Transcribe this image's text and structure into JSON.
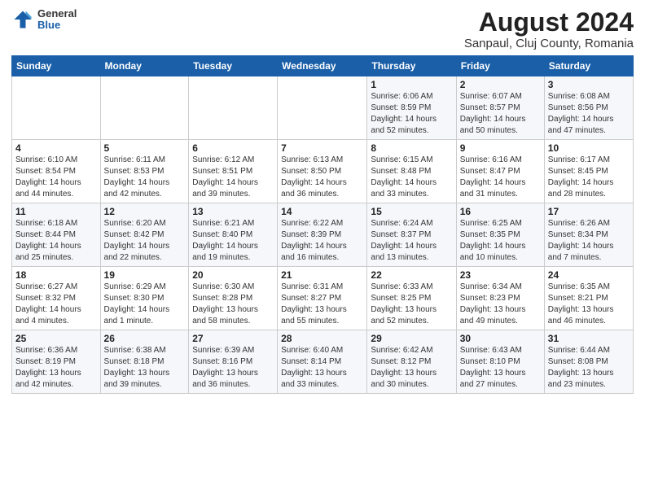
{
  "header": {
    "logo_general": "General",
    "logo_blue": "Blue",
    "title": "August 2024",
    "subtitle": "Sanpaul, Cluj County, Romania"
  },
  "weekdays": [
    "Sunday",
    "Monday",
    "Tuesday",
    "Wednesday",
    "Thursday",
    "Friday",
    "Saturday"
  ],
  "weeks": [
    [
      {
        "day": "",
        "info": ""
      },
      {
        "day": "",
        "info": ""
      },
      {
        "day": "",
        "info": ""
      },
      {
        "day": "",
        "info": ""
      },
      {
        "day": "1",
        "info": "Sunrise: 6:06 AM\nSunset: 8:59 PM\nDaylight: 14 hours\nand 52 minutes."
      },
      {
        "day": "2",
        "info": "Sunrise: 6:07 AM\nSunset: 8:57 PM\nDaylight: 14 hours\nand 50 minutes."
      },
      {
        "day": "3",
        "info": "Sunrise: 6:08 AM\nSunset: 8:56 PM\nDaylight: 14 hours\nand 47 minutes."
      }
    ],
    [
      {
        "day": "4",
        "info": "Sunrise: 6:10 AM\nSunset: 8:54 PM\nDaylight: 14 hours\nand 44 minutes."
      },
      {
        "day": "5",
        "info": "Sunrise: 6:11 AM\nSunset: 8:53 PM\nDaylight: 14 hours\nand 42 minutes."
      },
      {
        "day": "6",
        "info": "Sunrise: 6:12 AM\nSunset: 8:51 PM\nDaylight: 14 hours\nand 39 minutes."
      },
      {
        "day": "7",
        "info": "Sunrise: 6:13 AM\nSunset: 8:50 PM\nDaylight: 14 hours\nand 36 minutes."
      },
      {
        "day": "8",
        "info": "Sunrise: 6:15 AM\nSunset: 8:48 PM\nDaylight: 14 hours\nand 33 minutes."
      },
      {
        "day": "9",
        "info": "Sunrise: 6:16 AM\nSunset: 8:47 PM\nDaylight: 14 hours\nand 31 minutes."
      },
      {
        "day": "10",
        "info": "Sunrise: 6:17 AM\nSunset: 8:45 PM\nDaylight: 14 hours\nand 28 minutes."
      }
    ],
    [
      {
        "day": "11",
        "info": "Sunrise: 6:18 AM\nSunset: 8:44 PM\nDaylight: 14 hours\nand 25 minutes."
      },
      {
        "day": "12",
        "info": "Sunrise: 6:20 AM\nSunset: 8:42 PM\nDaylight: 14 hours\nand 22 minutes."
      },
      {
        "day": "13",
        "info": "Sunrise: 6:21 AM\nSunset: 8:40 PM\nDaylight: 14 hours\nand 19 minutes."
      },
      {
        "day": "14",
        "info": "Sunrise: 6:22 AM\nSunset: 8:39 PM\nDaylight: 14 hours\nand 16 minutes."
      },
      {
        "day": "15",
        "info": "Sunrise: 6:24 AM\nSunset: 8:37 PM\nDaylight: 14 hours\nand 13 minutes."
      },
      {
        "day": "16",
        "info": "Sunrise: 6:25 AM\nSunset: 8:35 PM\nDaylight: 14 hours\nand 10 minutes."
      },
      {
        "day": "17",
        "info": "Sunrise: 6:26 AM\nSunset: 8:34 PM\nDaylight: 14 hours\nand 7 minutes."
      }
    ],
    [
      {
        "day": "18",
        "info": "Sunrise: 6:27 AM\nSunset: 8:32 PM\nDaylight: 14 hours\nand 4 minutes."
      },
      {
        "day": "19",
        "info": "Sunrise: 6:29 AM\nSunset: 8:30 PM\nDaylight: 14 hours\nand 1 minute."
      },
      {
        "day": "20",
        "info": "Sunrise: 6:30 AM\nSunset: 8:28 PM\nDaylight: 13 hours\nand 58 minutes."
      },
      {
        "day": "21",
        "info": "Sunrise: 6:31 AM\nSunset: 8:27 PM\nDaylight: 13 hours\nand 55 minutes."
      },
      {
        "day": "22",
        "info": "Sunrise: 6:33 AM\nSunset: 8:25 PM\nDaylight: 13 hours\nand 52 minutes."
      },
      {
        "day": "23",
        "info": "Sunrise: 6:34 AM\nSunset: 8:23 PM\nDaylight: 13 hours\nand 49 minutes."
      },
      {
        "day": "24",
        "info": "Sunrise: 6:35 AM\nSunset: 8:21 PM\nDaylight: 13 hours\nand 46 minutes."
      }
    ],
    [
      {
        "day": "25",
        "info": "Sunrise: 6:36 AM\nSunset: 8:19 PM\nDaylight: 13 hours\nand 42 minutes."
      },
      {
        "day": "26",
        "info": "Sunrise: 6:38 AM\nSunset: 8:18 PM\nDaylight: 13 hours\nand 39 minutes."
      },
      {
        "day": "27",
        "info": "Sunrise: 6:39 AM\nSunset: 8:16 PM\nDaylight: 13 hours\nand 36 minutes."
      },
      {
        "day": "28",
        "info": "Sunrise: 6:40 AM\nSunset: 8:14 PM\nDaylight: 13 hours\nand 33 minutes."
      },
      {
        "day": "29",
        "info": "Sunrise: 6:42 AM\nSunset: 8:12 PM\nDaylight: 13 hours\nand 30 minutes."
      },
      {
        "day": "30",
        "info": "Sunrise: 6:43 AM\nSunset: 8:10 PM\nDaylight: 13 hours\nand 27 minutes."
      },
      {
        "day": "31",
        "info": "Sunrise: 6:44 AM\nSunset: 8:08 PM\nDaylight: 13 hours\nand 23 minutes."
      }
    ]
  ]
}
